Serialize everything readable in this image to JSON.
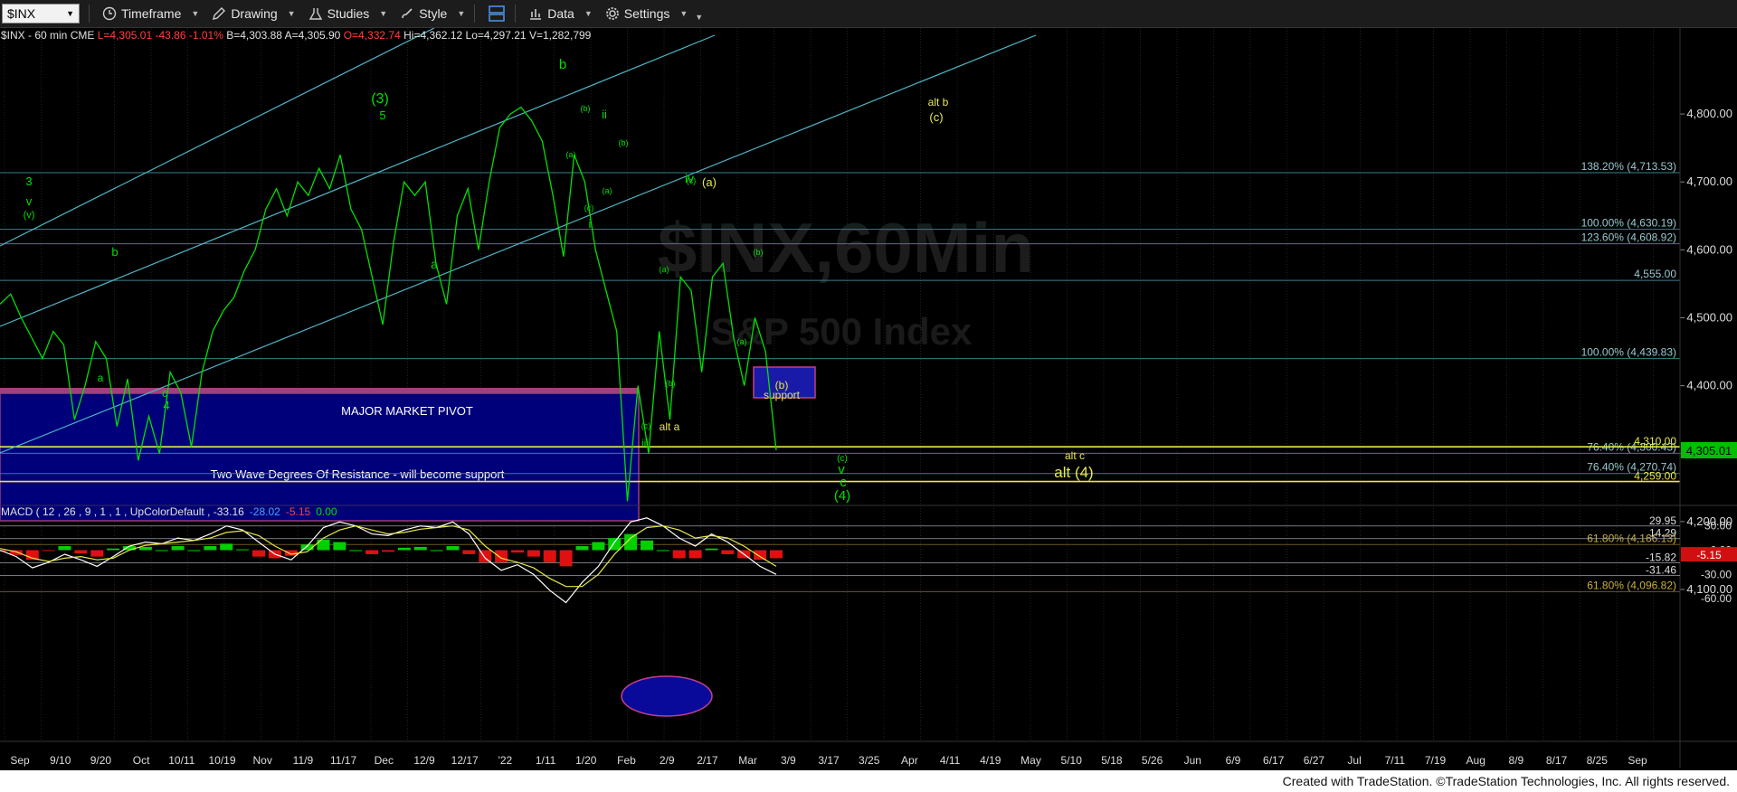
{
  "toolbar": {
    "symbol": "$INX",
    "timeframe": "Timeframe",
    "drawing": "Drawing",
    "studies": "Studies",
    "style": "Style",
    "data": "Data",
    "settings": "Settings"
  },
  "infobar": {
    "symbol": "$INX - 60 min",
    "exchange": "CME",
    "last": "L=4,305.01",
    "change": "-43.86",
    "pct": "-1.01%",
    "bid": "B=4,303.88",
    "ask": "A=4,305.90",
    "open": "O=4,332.74",
    "high": "Hi=4,362.12",
    "low": "Lo=4,297.21",
    "volume": "V=1,282,799"
  },
  "watermark": {
    "line1": "$INX,60Min",
    "line2": "S&P 500 Index"
  },
  "chart_data": {
    "type": "line",
    "title": "$INX - 60 min",
    "ylim": [
      4080,
      4860
    ],
    "y_ticks": [
      "4,800.00",
      "4,700.00",
      "4,600.00",
      "4,500.00",
      "4,400.00",
      "4,300.00",
      "4,200.00",
      "4,100.00"
    ],
    "x_ticks": [
      "Sep",
      "9/10",
      "9/20",
      "Oct",
      "10/11",
      "10/19",
      "Nov",
      "11/9",
      "11/17",
      "Dec",
      "12/9",
      "12/17",
      "'22",
      "1/11",
      "1/20",
      "Feb",
      "2/9",
      "2/17",
      "Mar",
      "3/9",
      "3/17",
      "3/25",
      "Apr",
      "4/11",
      "4/19",
      "May",
      "5/10",
      "5/18",
      "5/26",
      "Jun",
      "6/9",
      "6/17",
      "6/27",
      "Jul",
      "7/11",
      "7/19",
      "Aug",
      "8/9",
      "8/17",
      "8/25",
      "Sep"
    ],
    "series": [
      {
        "values": [
          4520,
          4535,
          4500,
          4470,
          4440,
          4480,
          4460,
          4350,
          4400,
          4465,
          4440,
          4340,
          4410,
          4290,
          4355,
          4300,
          4420,
          4390,
          4310,
          4420,
          4480,
          4510,
          4530,
          4570,
          4600,
          4660,
          4690,
          4650,
          4700,
          4680,
          4720,
          4690,
          4740,
          4660,
          4630,
          4560,
          4490,
          4610,
          4700,
          4680,
          4700,
          4580,
          4520,
          4650,
          4690,
          4600,
          4700,
          4780,
          4800,
          4810,
          4790,
          4760,
          4680,
          4590,
          4740,
          4700,
          4600,
          4540,
          4480,
          4230,
          4400,
          4300,
          4480,
          4350,
          4560,
          4540,
          4420,
          4560,
          4580,
          4470,
          4400,
          4500,
          4450,
          4305
        ]
      }
    ],
    "fib_levels": [
      {
        "label": "138.20% (4,713.53)",
        "value": 4713.53
      },
      {
        "label": "100.00% (4,630.19)",
        "value": 4630.19
      },
      {
        "label": "123.60% (4,608.92)",
        "value": 4608.92
      },
      {
        "label": "4,555.00",
        "value": 4555.0
      },
      {
        "label": "100.00% (4,439.83)",
        "value": 4439.83
      },
      {
        "label": "76.40% (4,300.43)",
        "value": 4300.43
      },
      {
        "label": "76.40% (4,270.74)",
        "value": 4270.74
      },
      {
        "label": "61.80% (4,166.13)",
        "value": 4166.13
      },
      {
        "label": "61.80% (4,096.82)",
        "value": 4096.82
      }
    ],
    "yellow_levels": [
      {
        "label": "4,310.00",
        "value": 4310.0
      },
      {
        "label": "4,259.00",
        "value": 4259.0
      }
    ],
    "price_marker": "4,305.01",
    "annotations": {
      "major_pivot": "MAJOR MARKET PIVOT",
      "resistance": "Two Wave Degrees Of Resistance - will become support",
      "support": "support",
      "support_b": "(b)",
      "alt_b": "alt b",
      "alt_b_c": "(c)",
      "alt_a": "alt a",
      "alt_c": "alt c",
      "alt_4": "alt (4)",
      "wave_3": "(3)",
      "wave_5": "5",
      "wave_b_top": "b",
      "wave_ii": "ii",
      "wave_i": "i",
      "wave_iv": "iv",
      "wave_a_yellow": "(a)",
      "wave_iii": "iii",
      "wave_c_small": "(c)",
      "wave_v": "v",
      "wave_c": "c",
      "wave_4_green": "(4)",
      "wave_a_dec": "a",
      "wave_3_left": "3",
      "wave_v_left": "v",
      "wave_v_paren": "(v)",
      "wave_b_sep": "b",
      "wave_a_sep": "a",
      "wave_c_oct": "c",
      "wave_4_oct": "4",
      "small_b1": "(b)",
      "small_a1": "(a)",
      "small_c1": "(c)",
      "small_a2": "(a)",
      "small_b2": "(b)",
      "small_c2": "(c)",
      "small_a3": "(a)",
      "small_b3": "(b)",
      "small_a4": "(a)",
      "small_b4": "(b)",
      "small_c3": "(c)"
    },
    "macd": {
      "label": "MACD ( 12 , 26 , 9 , 1 , 1 , UpColorDefault , -33.16",
      "v1": "-28.02",
      "v2": "-5.15",
      "v3": "0.00",
      "ylim": [
        -70,
        42
      ],
      "y_ticks": [
        "30.00",
        "0.00",
        "-30.00",
        "-60.00"
      ],
      "levels": [
        {
          "label": "29.95",
          "value": 29.95
        },
        {
          "label": "14.29",
          "value": 14.29
        },
        {
          "label": "-15.82",
          "value": -15.82
        },
        {
          "label": "-31.46",
          "value": -31.46
        }
      ],
      "marker": "-5.15",
      "macd_line": [
        0,
        -8,
        -22,
        -15,
        -5,
        -12,
        -20,
        -8,
        5,
        10,
        8,
        15,
        12,
        20,
        30,
        25,
        10,
        -5,
        -12,
        5,
        28,
        35,
        30,
        20,
        18,
        25,
        30,
        28,
        35,
        20,
        -10,
        -25,
        -18,
        -30,
        -50,
        -65,
        -40,
        -20,
        10,
        35,
        40,
        30,
        15,
        5,
        20,
        10,
        -5,
        -20,
        -30
      ],
      "signal_line": [
        2,
        -2,
        -10,
        -14,
        -10,
        -8,
        -12,
        -10,
        0,
        6,
        8,
        10,
        12,
        15,
        22,
        24,
        18,
        5,
        -5,
        -2,
        15,
        25,
        30,
        25,
        20,
        22,
        26,
        28,
        30,
        25,
        5,
        -10,
        -15,
        -22,
        -35,
        -45,
        -45,
        -30,
        -5,
        15,
        28,
        30,
        25,
        15,
        18,
        15,
        5,
        -8,
        -20
      ],
      "histogram": [
        -2,
        -6,
        -12,
        -1,
        5,
        -4,
        -8,
        2,
        5,
        4,
        0,
        5,
        0,
        5,
        8,
        1,
        -8,
        -10,
        -7,
        7,
        13,
        10,
        0,
        -5,
        -2,
        3,
        4,
        0,
        5,
        -5,
        -15,
        -15,
        -3,
        -8,
        -15,
        -20,
        5,
        10,
        15,
        20,
        12,
        0,
        -10,
        -10,
        2,
        -5,
        -10,
        -12,
        -10
      ]
    }
  },
  "footer": {
    "credit": "Created with TradeStation. ©TradeStation Technologies, Inc. All rights reserved."
  },
  "colors": {
    "accent": "#00d000",
    "fib": "#5fb8c4",
    "yellow": "#e8e84a",
    "pivot": "#000080"
  }
}
